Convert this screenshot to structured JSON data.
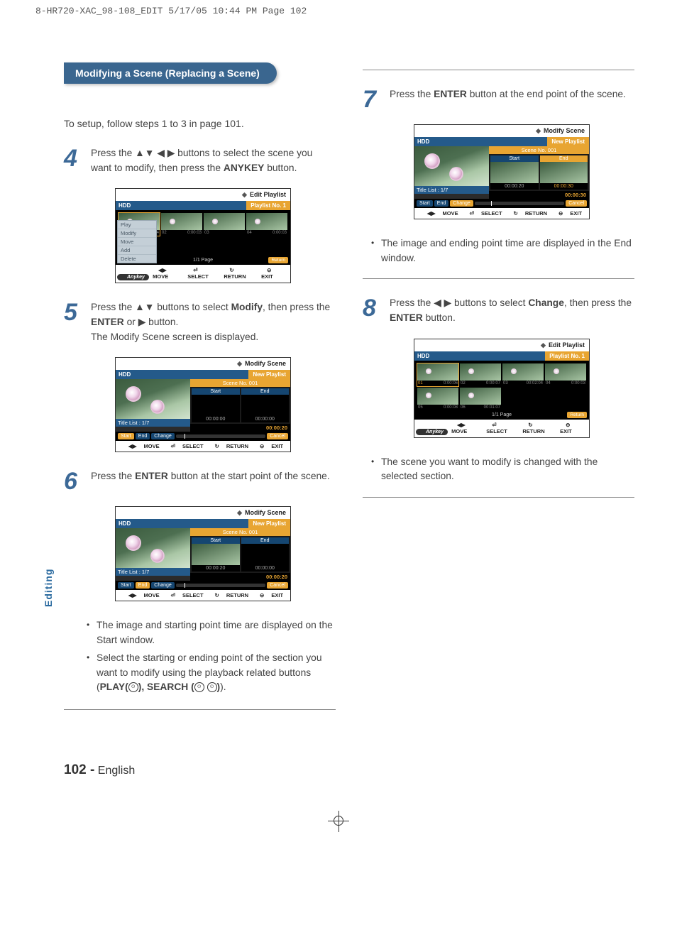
{
  "meta": {
    "header_line": "8-HR720-XAC_98-108_EDIT  5/17/05  10:44 PM  Page 102"
  },
  "heading": {
    "title": "Modifying a Scene (Replacing a Scene)",
    "intro": "To setup, follow steps 1 to 3 in page 101."
  },
  "steps": {
    "s4": {
      "num": "4",
      "text_a": "Press the ▲▼ ◀ ▶  buttons to select the scene you want to modify, then press the ",
      "bold_a": "ANYKEY",
      "text_b": " button."
    },
    "s5": {
      "num": "5",
      "text_a": "Press the ▲▼ buttons to select ",
      "bold_a": "Modify",
      "text_b": ", then press the ",
      "bold_b": "ENTER",
      "text_c": " or ▶ button.",
      "sub": "The Modify Scene screen is displayed."
    },
    "s6": {
      "num": "6",
      "text_a": "Press the ",
      "bold_a": "ENTER",
      "text_b": " button at the start point of the scene.",
      "note1": "The image and starting point time are displayed on the Start window.",
      "note2": "Select the starting or ending point of the section you want to modify using the playback related buttons (",
      "play_label": "PLAY(",
      "search_label": "SEARCH ("
    },
    "s7": {
      "num": "7",
      "text_a": "Press the ",
      "bold_a": "ENTER",
      "text_b": " button at the end point of the scene.",
      "note": "The image and ending point time are displayed in the End window."
    },
    "s8": {
      "num": "8",
      "text_a": "Press the ◀ ▶ buttons to select ",
      "bold_a": "Change",
      "text_b": ", then press the ",
      "bold_b": "ENTER",
      "text_c": " button.",
      "note": "The scene you want to modify is changed with the selected section."
    }
  },
  "mock": {
    "edit_playlist": "Edit Playlist",
    "modify_scene": "Modify Scene",
    "hdd": "HDD",
    "playlist_no": "Playlist No. 1",
    "new_playlist": "New Playlist",
    "scene_no": "Scene No. 001",
    "title_list": "Title List : 1/7",
    "start": "Start",
    "end": "End",
    "change": "Change",
    "cancel": "Cancel",
    "return": "Return",
    "page": "1/1 Page",
    "t_000000": "00:00:00",
    "t_000020": "00:00:20",
    "t_000030": "00:00:30",
    "t_000204": "00:02:04",
    "t_000006": "0:00:06",
    "t_000007": "0:00:07",
    "t_000008": "0:00:08",
    "t_000003": "0:00:03",
    "t_000005": "0:00:05",
    "t_000107": "00:01:07",
    "nav_move": "MOVE",
    "nav_select": "SELECT",
    "nav_return": "RETURN",
    "nav_exit": "EXIT",
    "anykey": "Anykey",
    "menu": {
      "play": "Play",
      "modify": "Modify",
      "move": "Move",
      "add": "Add",
      "delete": "Delete"
    },
    "scene_numbers": [
      "01",
      "02",
      "03",
      "04",
      "05",
      "06"
    ]
  },
  "side_tab": "Editing",
  "footer": {
    "page": "102 -",
    "lang": "English"
  }
}
